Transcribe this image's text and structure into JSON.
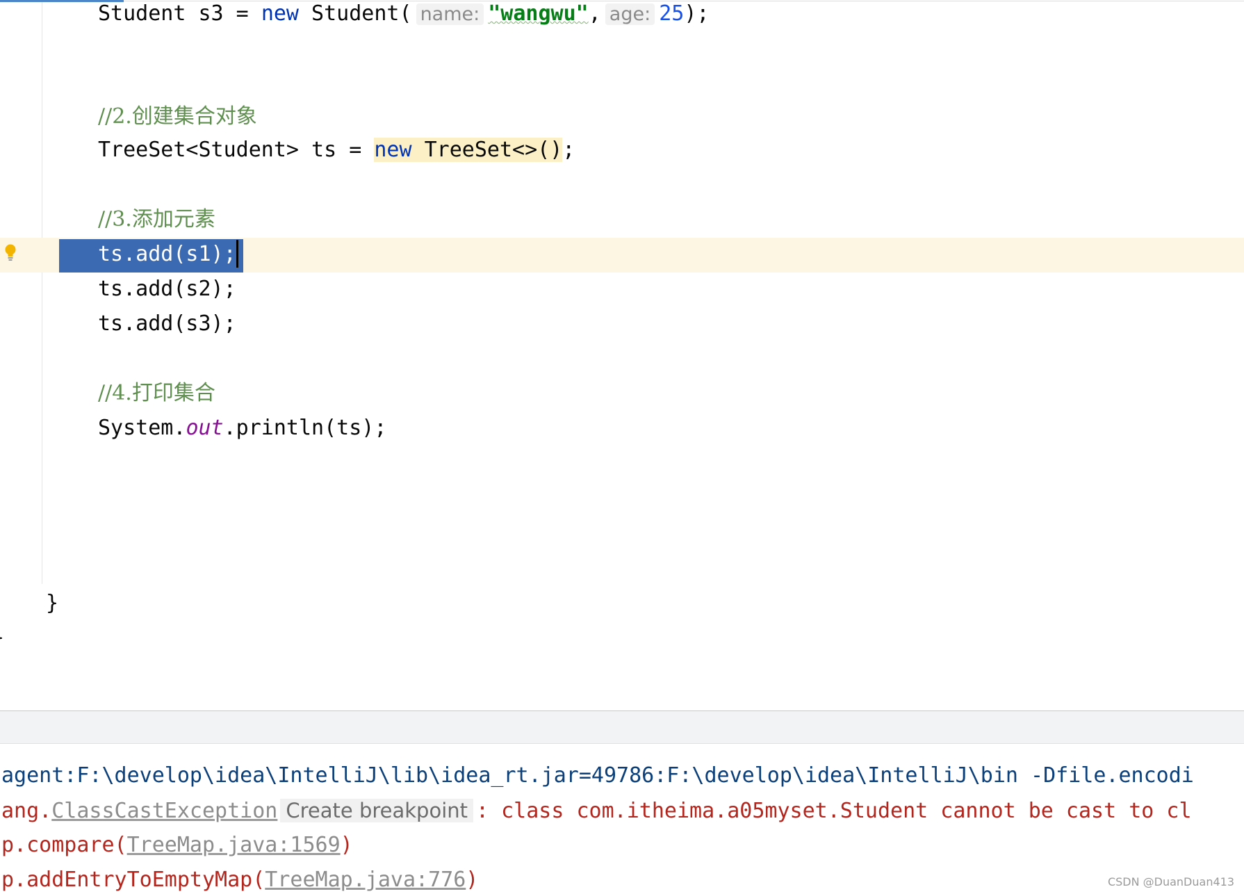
{
  "editor": {
    "lines": {
      "student_s3": {
        "prefix": "Student s3 = ",
        "kw_new": "new",
        "class_call": " Student(",
        "hint_name": "name:",
        "str_value": "\"wangwu\"",
        "comma": ",",
        "hint_age": "age:",
        "num_value": "25",
        "suffix": ");"
      },
      "comment_create": "//2.创建集合对象",
      "treeset_decl": {
        "prefix": "TreeSet<Student> ts = ",
        "kw_new": "new",
        "ctor": " TreeSet<>()",
        "suffix": ";"
      },
      "comment_add": "//3.添加元素",
      "add_s1": "ts.add(s1);",
      "add_s2": "ts.add(s2);",
      "add_s3": "ts.add(s3);",
      "comment_print": "//4.打印集合",
      "println": {
        "prefix": "System.",
        "field": "out",
        "suffix": ".println(ts);"
      },
      "method_close": "}",
      "class_close": "}"
    },
    "gutter_icon": "lightbulb-icon"
  },
  "console": {
    "line1": "agent:F:\\develop\\idea\\IntelliJ\\lib\\idea_rt.jar=49786:F:\\develop\\idea\\IntelliJ\\bin -Dfile.encodi",
    "line2": {
      "prefix": "ang.",
      "exception_link": "ClassCastException",
      "tooltip": "Create breakpoint",
      "message": ": class com.itheima.a05myset.Student cannot be cast to cl"
    },
    "line3": {
      "prefix": "p.compare(",
      "link": "TreeMap.java:1569",
      "suffix": ")"
    },
    "line4": {
      "prefix": "p.addEntryToEmptyMap(",
      "link": "TreeMap.java:776",
      "suffix": ")"
    }
  },
  "watermark": "CSDN @DuanDuan413"
}
